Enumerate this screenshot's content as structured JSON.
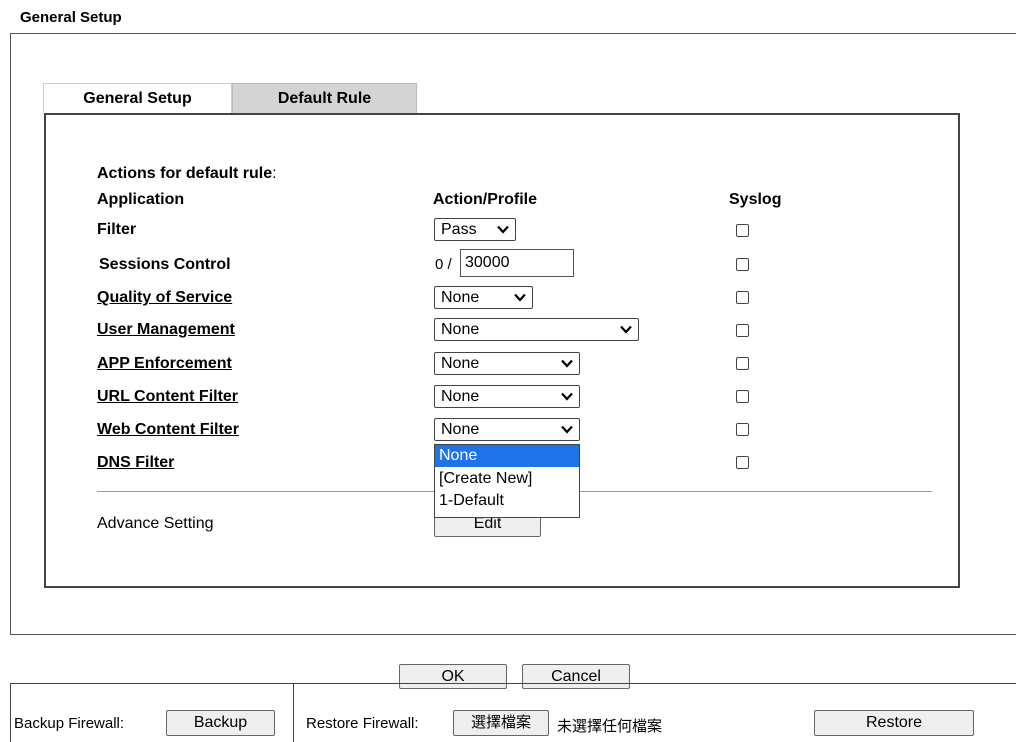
{
  "page_title": "General Setup",
  "tabs": [
    {
      "label": "General Setup"
    },
    {
      "label": "Default Rule"
    }
  ],
  "section": {
    "heading": "Actions for default rule",
    "heading_colon": ":",
    "col_application": "Application",
    "col_action": "Action/Profile",
    "col_syslog": "Syslog"
  },
  "rows": {
    "filter": {
      "label": "Filter",
      "value": "Pass"
    },
    "sessions": {
      "label": "Sessions Control",
      "prefix": "0 /",
      "value": "30000"
    },
    "qos": {
      "label": "Quality of Service",
      "value": "None"
    },
    "user_mgmt": {
      "label": "User Management",
      "value": "None"
    },
    "app_enf": {
      "label": "APP Enforcement",
      "value": "None"
    },
    "url_filter": {
      "label": "URL Content Filter",
      "value": "None"
    },
    "web_filter": {
      "label": "Web Content Filter",
      "value": "None"
    },
    "dns_filter": {
      "label": "DNS Filter"
    }
  },
  "dropdown_options": [
    "None",
    "[Create New]",
    "1-Default"
  ],
  "advance": {
    "label": "Advance Setting",
    "button": "Edit"
  },
  "footer": {
    "ok": "OK",
    "cancel": "Cancel"
  },
  "backup": {
    "label": "Backup Firewall:",
    "button": "Backup"
  },
  "restore": {
    "label": "Restore Firewall:",
    "choose_button": "選擇檔案",
    "no_file": "未選擇任何檔案",
    "button": "Restore"
  }
}
